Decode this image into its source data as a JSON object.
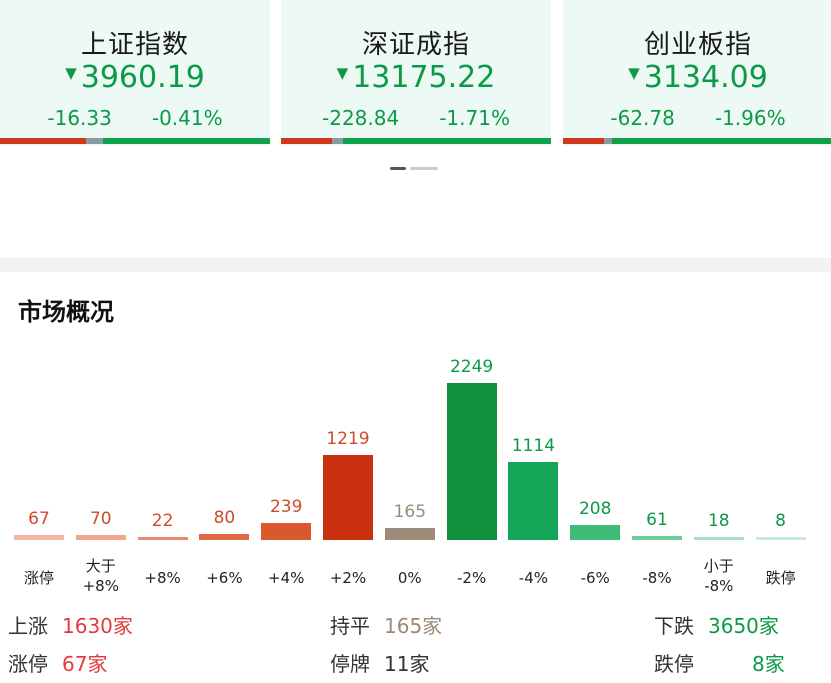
{
  "indices": [
    {
      "name": "上证指数",
      "price": "3960.19",
      "change": "-16.33",
      "pct": "-0.41%",
      "arrow": "▼",
      "ratio": {
        "up": 0.32,
        "flat": 0.06,
        "down": 0.62
      }
    },
    {
      "name": "深证成指",
      "price": "13175.22",
      "change": "-228.84",
      "pct": "-1.71%",
      "arrow": "▼",
      "ratio": {
        "up": 0.19,
        "flat": 0.04,
        "down": 0.77
      }
    },
    {
      "name": "创业板指",
      "price": "3134.09",
      "change": "-62.78",
      "pct": "-1.96%",
      "arrow": "▼",
      "ratio": {
        "up": 0.15,
        "flat": 0.03,
        "down": 0.82
      }
    }
  ],
  "section_title": "市场概况",
  "chart_data": {
    "type": "bar",
    "categories": [
      "涨停",
      "大于\n+8%",
      "+8%",
      "+6%",
      "+4%",
      "+2%",
      "0%",
      "-2%",
      "-4%",
      "-6%",
      "-8%",
      "小于\n-8%",
      "跌停"
    ],
    "values": [
      67,
      70,
      22,
      80,
      239,
      1219,
      165,
      2249,
      1114,
      208,
      61,
      18,
      8
    ],
    "colors": [
      "#f2b8a6",
      "#efa58e",
      "#e58a6f",
      "#e06a45",
      "#d9582e",
      "#c8300f",
      "#9e8a78",
      "#11913c",
      "#13a658",
      "#3fbb78",
      "#70cc97",
      "#a9dfc0",
      "#c8ebd6"
    ],
    "label_colors": [
      "#d04a2a",
      "#d04a2a",
      "#d04a2a",
      "#d04a2a",
      "#d04a2a",
      "#d04a2a",
      "#9a8a78",
      "#0d9a47",
      "#0d9a47",
      "#0d9a47",
      "#0d9a47",
      "#0d9a47",
      "#0d9a47"
    ],
    "ylim": [
      0,
      2249
    ]
  },
  "summary": {
    "up_label": "上涨",
    "up_value": "1630家",
    "flat_label": "持平",
    "flat_value": "165家",
    "down_label": "下跌",
    "down_value": "3650家",
    "limit_up_label": "涨停",
    "limit_up_value": "67家",
    "suspend_label": "停牌",
    "suspend_value": "11家",
    "limit_down_label": "跌停",
    "limit_down_value": "8家"
  }
}
